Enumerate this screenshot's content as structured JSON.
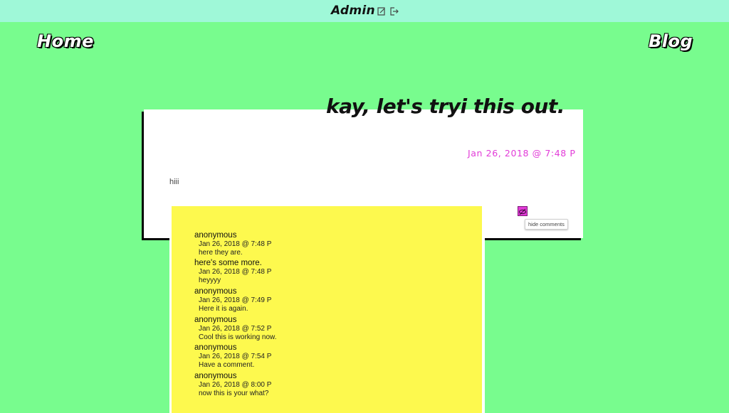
{
  "admin": {
    "title": "Admin",
    "edit_icon": "edit-icon",
    "logout_icon": "logout-icon"
  },
  "nav": {
    "home": "Home",
    "blog": "Blog"
  },
  "post": {
    "title": "kay, let's tryi this out.",
    "date": "Jan 26, 2018 @ 7:48 P",
    "body": "hiii",
    "toggle_icon": "hide-eye-icon",
    "tooltip": "hide comments"
  },
  "comments": [
    {
      "author": "anonymous",
      "date": "Jan 26, 2018 @ 7:48 P",
      "text": "here they are."
    },
    {
      "author": "here's some more.",
      "date": "Jan 26, 2018 @ 7:48 P",
      "text": "heyyyy"
    },
    {
      "author": "anonymous",
      "date": "Jan 26, 2018 @ 7:49 P",
      "text": "Here it is again."
    },
    {
      "author": "anonymous",
      "date": "Jan 26, 2018 @ 7:52 P",
      "text": "Cool this is working now."
    },
    {
      "author": "anonymous",
      "date": "Jan 26, 2018 @ 7:54 P",
      "text": "Have a comment."
    },
    {
      "author": "anonymous",
      "date": "Jan 26, 2018 @ 8:00 P",
      "text": "now this is your what?"
    }
  ],
  "colors": {
    "page_bg": "#78fc8e",
    "admin_bar": "#9ff8d8",
    "accent": "#e23bd8",
    "comments_bg": "#fdf94e"
  }
}
